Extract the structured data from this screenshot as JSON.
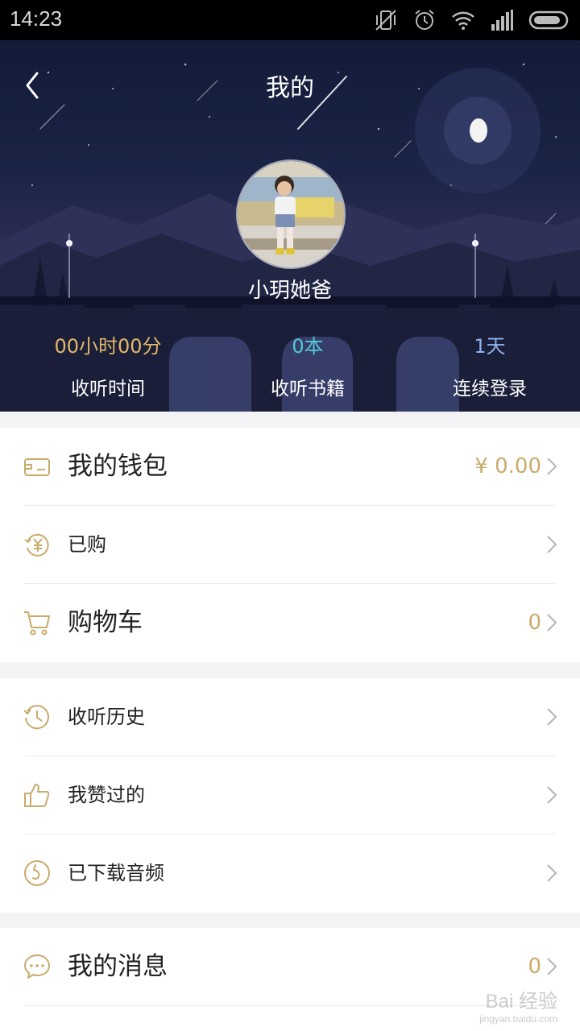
{
  "status_bar": {
    "time": "14:23"
  },
  "header": {
    "title": "我的",
    "username": "小玥她爸"
  },
  "stats": [
    {
      "value": "00小时00分",
      "label": "收听时间",
      "color": "#e2b86a"
    },
    {
      "value": "0本",
      "label": "收听书籍",
      "color": "#55c7d6"
    },
    {
      "value": "1天",
      "label": "连续登录",
      "color": "#8fb3ee"
    }
  ],
  "menu": {
    "wallet": {
      "label": "我的钱包",
      "value": "¥ 0.00",
      "icon": "wallet-icon"
    },
    "purchased": {
      "label": "已购",
      "icon": "yen-refresh-icon"
    },
    "cart": {
      "label": "购物车",
      "value": "0",
      "icon": "cart-icon"
    },
    "history": {
      "label": "收听历史",
      "icon": "history-icon"
    },
    "liked": {
      "label": "我赞过的",
      "icon": "thumbs-up-icon"
    },
    "downloaded": {
      "label": "已下载音频",
      "icon": "download-audio-icon"
    },
    "messages": {
      "label": "我的消息",
      "value": "0",
      "icon": "chat-icon"
    }
  },
  "watermark": {
    "brand": "Bai 经验",
    "url": "jingyan.baidu.com"
  },
  "colors": {
    "accent": "#c9ab6c",
    "chevron": "#b5b5b5"
  }
}
